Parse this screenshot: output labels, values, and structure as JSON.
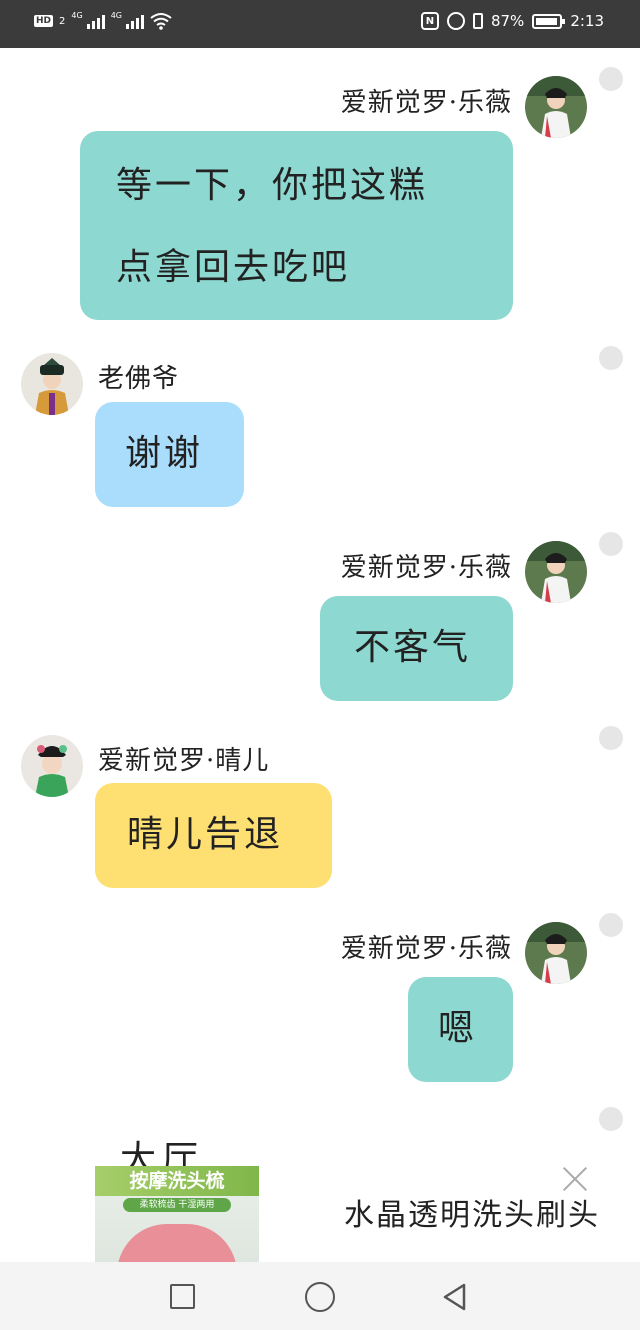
{
  "status_bar": {
    "battery": "87%",
    "time": "2:13",
    "network1": "4G",
    "network2": "4G",
    "hd": "HD",
    "sim": "2"
  },
  "messages": [
    {
      "side": "right",
      "sender": "爱新觉罗·乐薇",
      "lines": [
        "等一下，你把这糕",
        "点拿回去吃吧"
      ],
      "color": "#8dd8d0"
    },
    {
      "side": "left",
      "sender": "老佛爷",
      "lines": [
        "谢谢"
      ],
      "color": "#a9ddfb"
    },
    {
      "side": "right",
      "sender": "爱新觉罗·乐薇",
      "lines": [
        "不客气"
      ],
      "color": "#8dd8d0"
    },
    {
      "side": "left",
      "sender": "爱新觉罗·晴儿",
      "lines": [
        "晴儿告退"
      ],
      "color": "#fedf72"
    },
    {
      "side": "right",
      "sender": "爱新觉罗·乐薇",
      "lines": [
        "嗯"
      ],
      "color": "#8dd8d0"
    }
  ],
  "ad": {
    "partial_title": "大厅",
    "image_headline": "按摩洗头梳",
    "image_sub": "柔软梳齿 干湿两用",
    "text": "水晶透明洗头刷头"
  }
}
